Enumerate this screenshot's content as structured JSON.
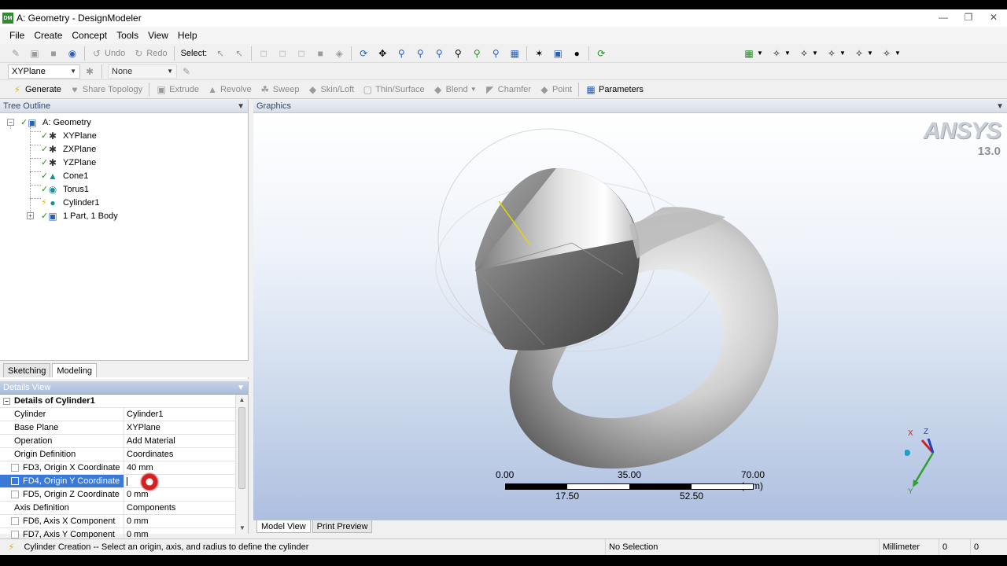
{
  "window": {
    "title": "A: Geometry - DesignModeler",
    "app_icon": "DM"
  },
  "menu": [
    "File",
    "Create",
    "Concept",
    "Tools",
    "View",
    "Help"
  ],
  "toolbar1": {
    "undo": "Undo",
    "redo": "Redo",
    "select_label": "Select:"
  },
  "toolbar2": {
    "plane_value": "XYPlane",
    "sketch_value": "None"
  },
  "toolbar3": {
    "generate": "Generate",
    "share_topology": "Share Topology",
    "extrude": "Extrude",
    "revolve": "Revolve",
    "sweep": "Sweep",
    "skin_loft": "Skin/Loft",
    "thin_surface": "Thin/Surface",
    "blend": "Blend",
    "chamfer": "Chamfer",
    "point": "Point",
    "parameters": "Parameters"
  },
  "tree": {
    "header": "Tree Outline",
    "root": "A: Geometry",
    "items": [
      "XYPlane",
      "ZXPlane",
      "YZPlane",
      "Cone1",
      "Torus1",
      "Cylinder1",
      "1 Part, 1 Body"
    ]
  },
  "left_tabs": [
    "Sketching",
    "Modeling"
  ],
  "details": {
    "header": "Details View",
    "group": "Details of Cylinder1",
    "rows": [
      {
        "label": "Cylinder",
        "value": "Cylinder1"
      },
      {
        "label": "Base Plane",
        "value": "XYPlane"
      },
      {
        "label": "Operation",
        "value": "Add Material"
      },
      {
        "label": "Origin Definition",
        "value": "Coordinates"
      },
      {
        "label": "FD3, Origin X Coordinate",
        "value": "40 mm"
      },
      {
        "label": "FD4, Origin Y Coordinate",
        "value": ""
      },
      {
        "label": "FD5, Origin Z Coordinate",
        "value": "0 mm"
      },
      {
        "label": "Axis Definition",
        "value": "Components"
      },
      {
        "label": "FD6, Axis X Component",
        "value": "0 mm"
      },
      {
        "label": "FD7, Axis Y Component",
        "value": "0 mm"
      }
    ]
  },
  "graphics": {
    "header": "Graphics",
    "logo": "ANSYS",
    "version": "13.0",
    "scale": {
      "labels_top": [
        "0.00",
        "35.00",
        "70.00 (mm)"
      ],
      "labels_bottom": [
        "17.50",
        "52.50"
      ]
    },
    "triad": {
      "x": "X",
      "y": "Y",
      "z": "Z"
    },
    "colors": {
      "x_axis": "#d42020",
      "y_axis": "#30a030",
      "z_axis": "#2040c0",
      "bg_bottom": "#aebfe0"
    }
  },
  "view_tabs": [
    "Model View",
    "Print Preview"
  ],
  "status": {
    "message": "Cylinder Creation -- Select an origin, axis, and radius to define the cylinder",
    "selection": "No Selection",
    "units": "Millimeter",
    "v1": "0",
    "v2": "0"
  }
}
